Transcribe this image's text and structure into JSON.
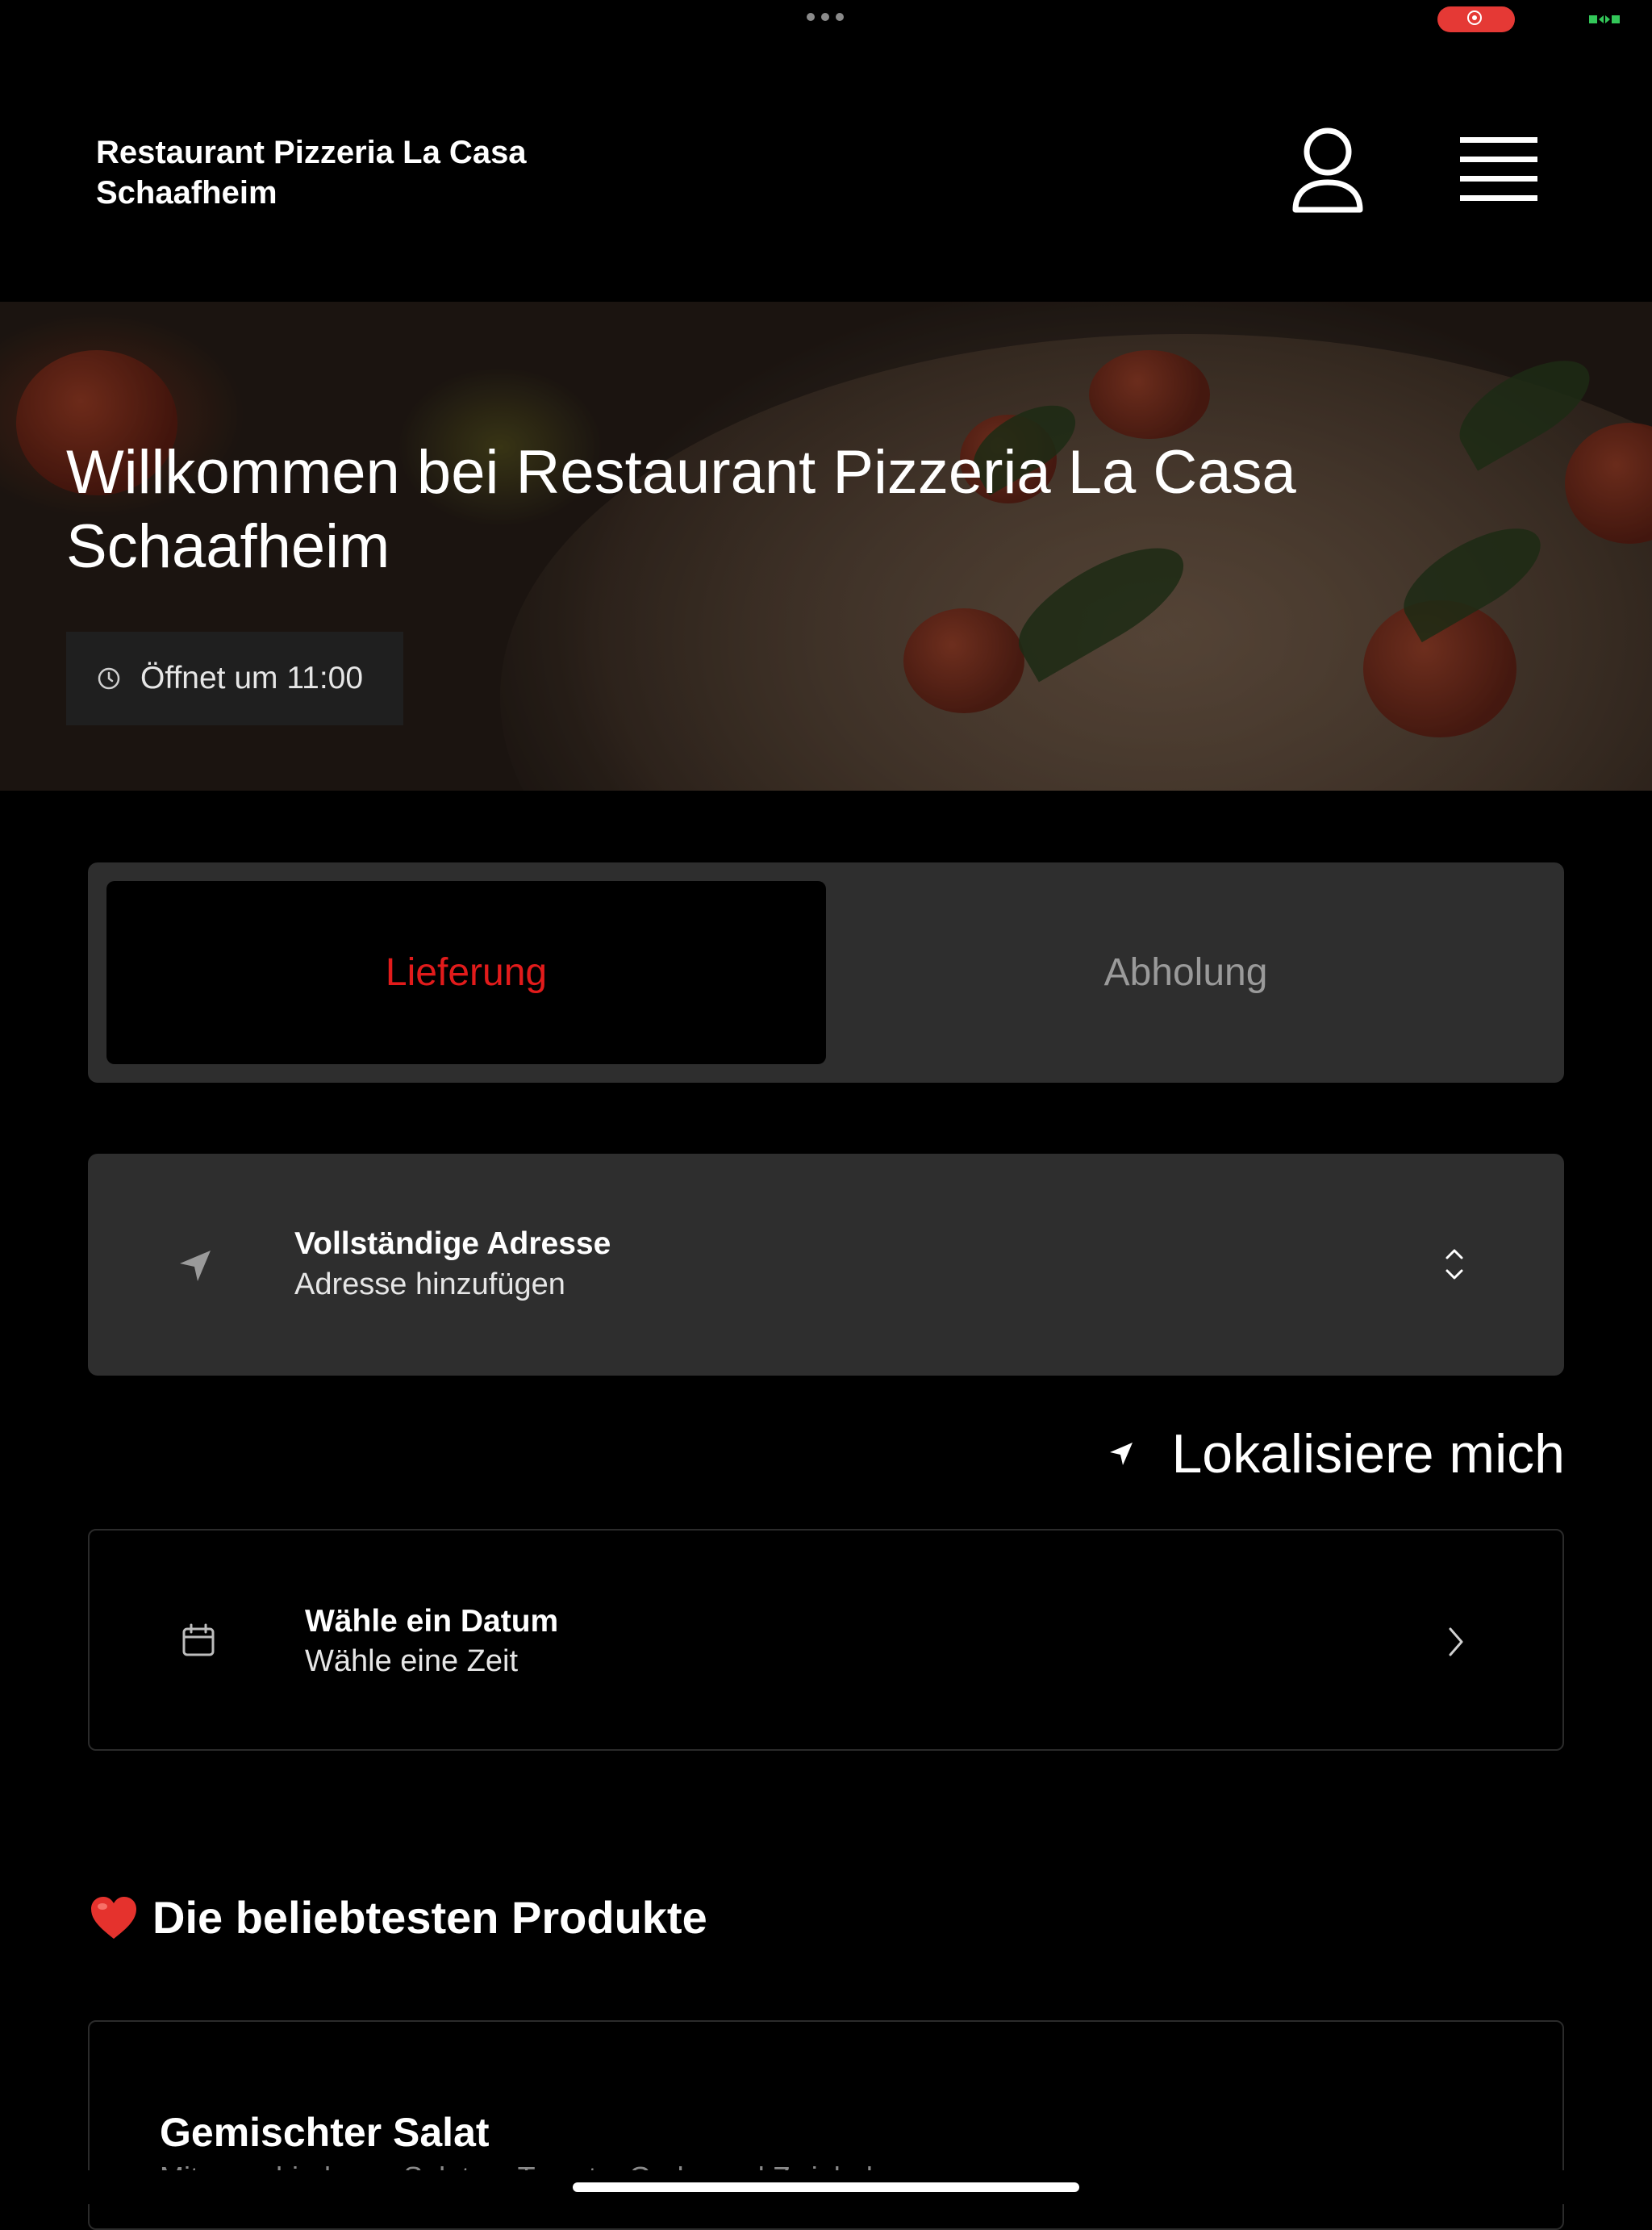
{
  "header": {
    "brand_line1": "Restaurant Pizzeria La Casa",
    "brand_line2": "Schaafheim"
  },
  "hero": {
    "title_line1": "Willkommen bei Restaurant Pizzeria La Casa",
    "title_line2": "Schaafheim",
    "hours_text": "Öffnet um 11:00"
  },
  "mode_toggle": {
    "delivery_label": "Lieferung",
    "pickup_label": "Abholung",
    "selected": "Lieferung"
  },
  "address": {
    "title": "Vollständige Adresse",
    "subtitle": "Adresse hinzufügen"
  },
  "locate": {
    "label": "Lokalisiere mich"
  },
  "date": {
    "title": "Wähle ein Datum",
    "subtitle": "Wähle eine Zeit"
  },
  "popular": {
    "heading": "Die beliebtesten Produkte",
    "products": [
      {
        "name": "Gemischter Salat",
        "description": "Mit verschiedenen Salaten, Tomate, Gurke und Zwiebel"
      }
    ]
  },
  "colors": {
    "accent": "#e21b1b",
    "card_bg": "#2e2e2e",
    "background": "#000000"
  },
  "icons": {
    "account": "person-icon",
    "menu": "hamburger-menu-icon",
    "clock": "clock-icon",
    "location": "navigation-arrow-icon",
    "expand": "chevron-up-down-icon",
    "calendar": "calendar-icon",
    "chevron": "chevron-right-icon",
    "heart": "heart-icon"
  }
}
